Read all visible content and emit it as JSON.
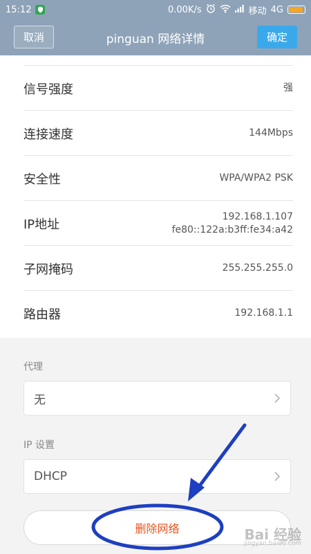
{
  "status_bar": {
    "time": "15:12",
    "network_speed": "0.00K/s",
    "carrier": "移动",
    "network_type": "4G"
  },
  "title_bar": {
    "cancel_label": "取消",
    "title": "pinguan  网络详情",
    "confirm_label": "确定"
  },
  "info_rows": [
    {
      "label": "信号强度",
      "value": "强"
    },
    {
      "label": "连接速度",
      "value": "144Mbps"
    },
    {
      "label": "安全性",
      "value": "WPA/WPA2 PSK"
    },
    {
      "label": "IP地址",
      "value_line1": "192.168.1.107",
      "value_line2": "fe80::122a:b3ff:fe34:a42"
    },
    {
      "label": "子网掩码",
      "value": "255.255.255.0"
    },
    {
      "label": "路由器",
      "value": "192.168.1.1"
    }
  ],
  "proxy": {
    "label": "代理",
    "value": "无"
  },
  "ip_settings": {
    "label": "IP 设置",
    "value": "DHCP"
  },
  "delete_button": {
    "label": "删除网络"
  },
  "watermark": {
    "text": "Bai 经验",
    "sub": "jingyan.baidu.com"
  },
  "colors": {
    "header_bg": "#8ea3b8",
    "confirm_bg": "#3aa9ec",
    "delete_text": "#e8541d",
    "annotation": "#1e3fbf",
    "battery": "#f6a623"
  }
}
